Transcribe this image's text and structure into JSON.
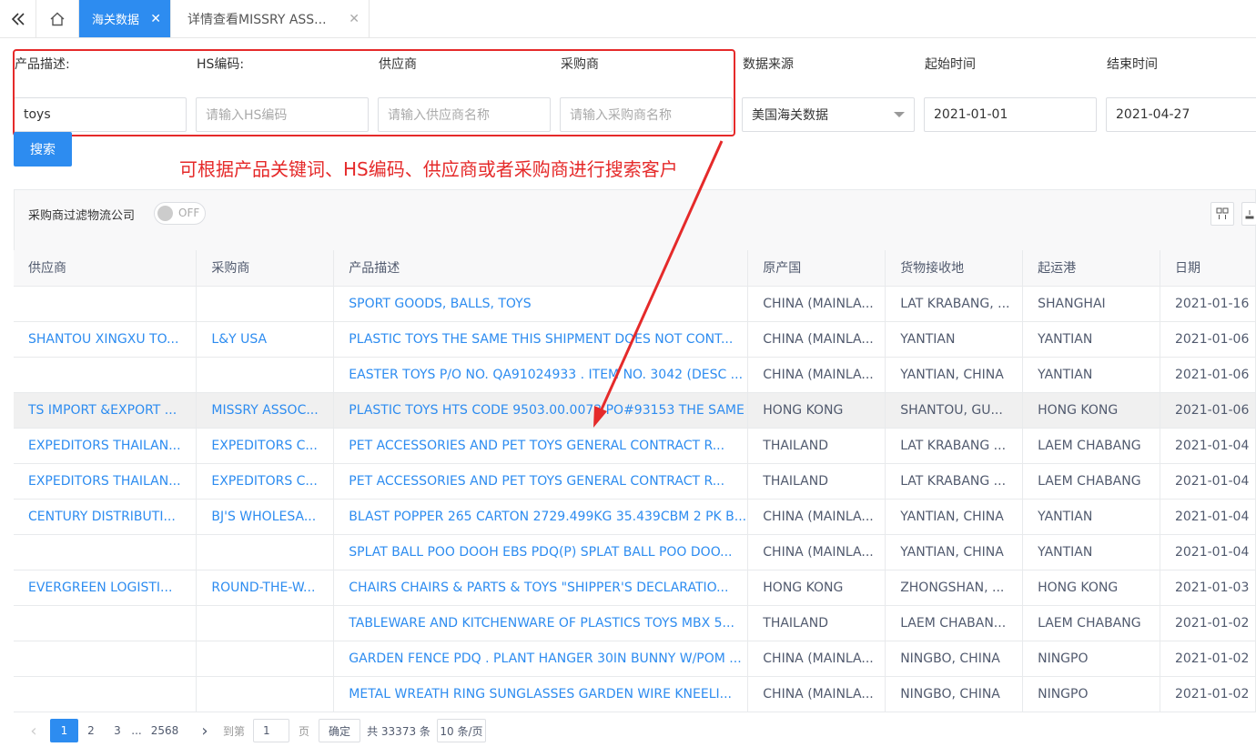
{
  "tabs": {
    "active": {
      "label": "海关数据",
      "close": "✕"
    },
    "detail": {
      "label": "详情查看MISSRY ASS...",
      "close": "✕"
    }
  },
  "filters": {
    "product_label": "产品描述:",
    "product_value": "toys",
    "hs_label": "HS编码:",
    "hs_placeholder": "请输入HS编码",
    "supplier_label": "供应商",
    "supplier_placeholder": "请输入供应商名称",
    "buyer_label": "采购商",
    "buyer_placeholder": "请输入采购商名称",
    "source_label": "数据来源",
    "source_value": "美国海关数据",
    "start_label": "起始时间",
    "start_value": "2021-01-01",
    "end_label": "结束时间",
    "end_value": "2021-04-27",
    "search_label": "搜索"
  },
  "annotation": "可根据产品关键词、HS编码、供应商或者采购商进行搜索客户",
  "filterbar": {
    "label": "采购商过滤物流公司",
    "switch": "OFF"
  },
  "table": {
    "columns": [
      "供应商",
      "采购商",
      "产品描述",
      "原产国",
      "货物接收地",
      "起运港",
      "日期"
    ],
    "rows": [
      [
        "",
        "",
        "SPORT GOODS, BALLS, TOYS",
        "CHINA (MAINLA...",
        "LAT KRABANG, ...",
        "SHANGHAI",
        "2021-01-16"
      ],
      [
        "SHANTOU XINGXU TO...",
        "L&Y USA",
        "PLASTIC TOYS THE SAME THIS SHIPMENT DOES NOT CONT...",
        "CHINA (MAINLA...",
        "YANTIAN",
        "YANTIAN",
        "2021-01-06"
      ],
      [
        "",
        "",
        "EASTER TOYS P/O NO. QA91024933 . ITEM NO. 3042 (DESC ...",
        "CHINA (MAINLA...",
        "YANTIAN, CHINA",
        "YANTIAN",
        "2021-01-06"
      ],
      [
        "TS IMPORT &EXPORT ...",
        "MISSRY ASSOC...",
        "PLASTIC TOYS HTS CODE 9503.00.0073 PO#93153 THE SAME",
        "HONG KONG",
        "SHANTOU, GU...",
        "HONG KONG",
        "2021-01-06"
      ],
      [
        "EXPEDITORS THAILAN...",
        "EXPEDITORS C...",
        "PET ACCESSORIES AND PET TOYS GENERAL CONTRACT R...",
        "THAILAND",
        "LAT KRABANG ...",
        "LAEM CHABANG",
        "2021-01-04"
      ],
      [
        "EXPEDITORS THAILAN...",
        "EXPEDITORS C...",
        "PET ACCESSORIES AND PET TOYS GENERAL CONTRACT R...",
        "THAILAND",
        "LAT KRABANG ...",
        "LAEM CHABANG",
        "2021-01-04"
      ],
      [
        "CENTURY DISTRIBUTI...",
        "BJ'S WHOLESA...",
        "BLAST POPPER 265 CARTON 2729.499KG 35.439CBM 2 PK B...",
        "CHINA (MAINLA...",
        "YANTIAN, CHINA",
        "YANTIAN",
        "2021-01-04"
      ],
      [
        "",
        "",
        "SPLAT BALL POO DOOH EBS PDQ(P) SPLAT BALL POO DOO...",
        "CHINA (MAINLA...",
        "YANTIAN, CHINA",
        "YANTIAN",
        "2021-01-04"
      ],
      [
        "EVERGREEN LOGISTI...",
        "ROUND-THE-W...",
        "CHAIRS CHAIRS & PARTS & TOYS \"SHIPPER'S DECLARATIO...",
        "HONG KONG",
        "ZHONGSHAN, ...",
        "HONG KONG",
        "2021-01-03"
      ],
      [
        "",
        "",
        "TABLEWARE AND KITCHENWARE OF PLASTICS TOYS MBX 5...",
        "THAILAND",
        "LAEM CHABAN...",
        "LAEM CHABANG",
        "2021-01-02"
      ],
      [
        "",
        "",
        "GARDEN FENCE PDQ . PLANT HANGER 30IN BUNNY W/POM ...",
        "CHINA (MAINLA...",
        "NINGBO, CHINA",
        "NINGPO",
        "2021-01-02"
      ],
      [
        "",
        "",
        "METAL WREATH RING SUNGLASSES GARDEN WIRE KNEELI...",
        "CHINA (MAINLA...",
        "NINGBO, CHINA",
        "NINGPO",
        "2021-01-02"
      ]
    ],
    "highlighted_row": 3
  },
  "pagination": {
    "prev": "‹",
    "p1": "1",
    "p2": "2",
    "p3": "3",
    "ellipsis": "...",
    "last": "2568",
    "next": "›",
    "goto_label": "到第",
    "goto_value": "1",
    "page_unit": "页",
    "confirm": "确定",
    "total": "共 33373 条",
    "page_size": "10 条/页"
  },
  "colors": {
    "accent": "#2d8cf0",
    "annotation": "#e52a2a"
  }
}
